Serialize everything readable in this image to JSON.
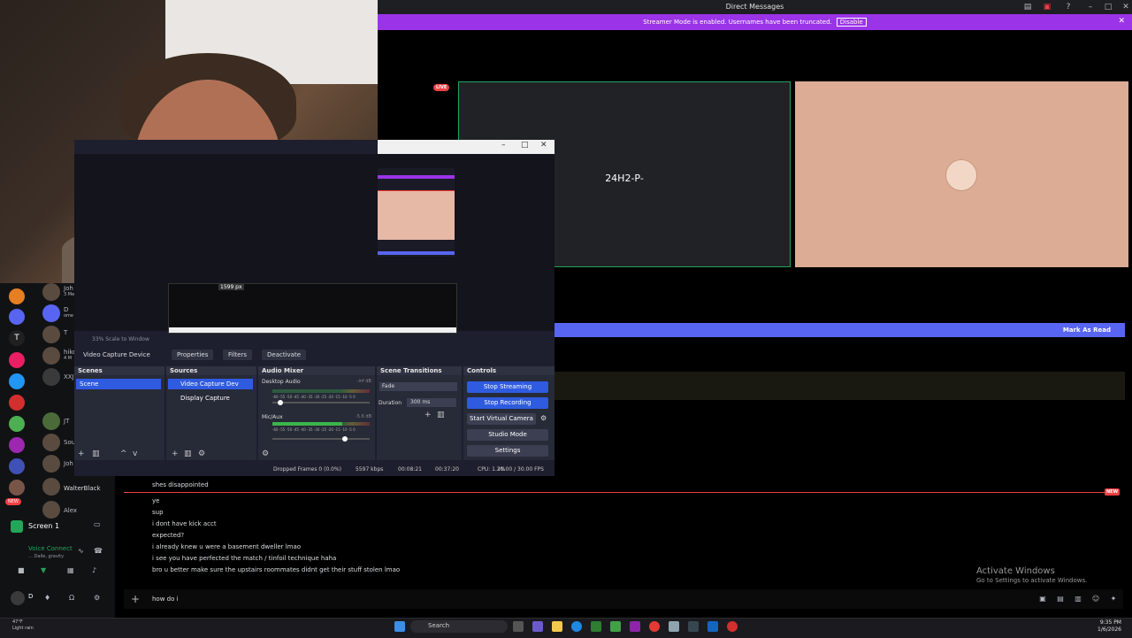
{
  "window": {
    "title": "Direct Messages"
  },
  "banner": {
    "text": "Streamer Mode is enabled. Usernames have been truncated.",
    "button": "Disable"
  },
  "stream": {
    "tile_name": "24H2-P-",
    "live_badge": "LIVE"
  },
  "unread": {
    "mark_as_read": "Mark As Read"
  },
  "rail": {
    "dms": [
      {
        "name": "Joh",
        "sub": "3 Me"
      },
      {
        "name": "D",
        "sub": "ome"
      },
      {
        "name": "T",
        "sub": ""
      },
      {
        "name": "hiko",
        "sub": "4 M"
      },
      {
        "name": "XXJ",
        "sub": ""
      },
      {
        "name": "JT",
        "sub": ""
      },
      {
        "name": "Sou",
        "sub": ""
      },
      {
        "name": "Joh",
        "sub": ""
      },
      {
        "name": "WalterBlack",
        "sub": ""
      },
      {
        "name": "Alex",
        "sub": ""
      }
    ],
    "screen_label": "Screen 1",
    "voice_status": "Voice Connect",
    "voice_sub": "… Dalle, gravity",
    "user_name": "D",
    "new_badge": "NEW"
  },
  "obs": {
    "preview_size": "1599 px",
    "scale_text": "33%   Scale to Window",
    "source_name": "Video Capture Device",
    "btn_properties": "Properties",
    "btn_filters": "Filters",
    "btn_deactivate": "Deactivate",
    "scenes": {
      "title": "Scenes",
      "items": [
        "Scene"
      ]
    },
    "sources": {
      "title": "Sources",
      "items": [
        "Video Capture Dev",
        "Display Capture"
      ]
    },
    "mixer": {
      "title": "Audio Mixer",
      "channels": [
        {
          "name": "Desktop Audio",
          "db": "-inf dB",
          "level": 0.05
        },
        {
          "name": "Mic/Aux",
          "db": "-5.6 dB",
          "level": 0.72
        }
      ],
      "ticks": "-60 -55 -50 -45 -40 -35 -30 -25 -20 -15 -10 -5 0"
    },
    "transitions": {
      "title": "Scene Transitions",
      "type": "Fade",
      "duration_label": "Duration",
      "duration_value": "300 ms"
    },
    "controls": {
      "title": "Controls",
      "buttons": [
        "Stop Streaming",
        "Stop Recording",
        "Start Virtual Camera",
        "Studio Mode",
        "Settings"
      ]
    },
    "status": {
      "dropped": "Dropped Frames 0 (0.0%)",
      "bitrate": "5597 kbps",
      "stream_time": "00:08:21",
      "rec_time": "00:37:20",
      "cpu": "CPU: 1.2%",
      "fps": "30.00 / 30.00 FPS"
    }
  },
  "chat": {
    "messages": [
      "shes disappointed",
      "ye",
      "sup",
      "i dont have kick acct",
      "expected?",
      "i already knew u were a basement dweller lmao",
      "i see you have perfected the match / tinfoil technique haha",
      "bro u better make sure the upstairs roommates didnt get their stuff stolen lmao"
    ],
    "new_badge": "NEW",
    "input_value": "how do i"
  },
  "activate": {
    "line1": "Activate Windows",
    "line2": "Go to Settings to activate Windows."
  },
  "taskbar": {
    "search": "Search",
    "weather_temp": "47°F",
    "weather_desc": "Light rain",
    "time": "9:35 PM",
    "date": "1/6/2026"
  },
  "colors": {
    "accent": "#5865f2",
    "streamer": "#9b34e8",
    "live": "#ed4245",
    "obs_blue": "#2f5be0"
  }
}
